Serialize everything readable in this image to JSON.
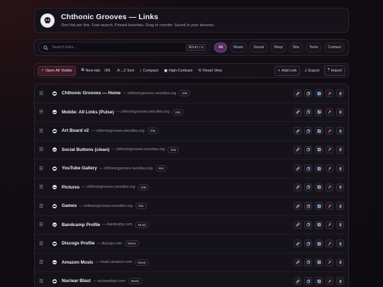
{
  "header": {
    "title": "Chthonic Grooves — Links",
    "subtitle": "One link per line. Fast search. Pinned favorites. Drag to reorder. Saved in your browser."
  },
  "search": {
    "placeholder": "Search links...",
    "shortcut": "⌘/Ctrl + K",
    "filters": [
      {
        "label": "All",
        "active": true
      },
      {
        "label": "Music",
        "active": false
      },
      {
        "label": "Social",
        "active": false
      },
      {
        "label": "Shop",
        "active": false
      },
      {
        "label": "Site",
        "active": false
      },
      {
        "label": "Tools",
        "active": false
      },
      {
        "label": "Contact",
        "active": false
      }
    ]
  },
  "toolbar": {
    "open_all": "Open All Visible",
    "new_tab_label": "New-tab:",
    "new_tab_value": "ON",
    "sort": "A→Z Sort",
    "compact": "Compact",
    "contrast": "High-Contrast",
    "reset": "Reset View",
    "add": "Add Link",
    "export": "Export",
    "import": "Import"
  },
  "links": [
    {
      "name": "Chthonic Grooves — Home",
      "domain": "chthonicgrooves.neocities.org",
      "tag": "Site"
    },
    {
      "name": "Mobile: All Links (Pulse)",
      "domain": "chthonicgrooves.neocities.org",
      "tag": "Site"
    },
    {
      "name": "Art Board v2",
      "domain": "chthonicgrooves.neocities.org",
      "tag": "Site"
    },
    {
      "name": "Social Buttons (clean)",
      "domain": "chthonicgrooves.neocities.org",
      "tag": "Site"
    },
    {
      "name": "YouTube Gallery",
      "domain": "chthonicgrooves.neocities.org",
      "tag": "Site"
    },
    {
      "name": "Pictures",
      "domain": "chthonicgrooves.neocities.org",
      "tag": "Site"
    },
    {
      "name": "Games",
      "domain": "chthonicgrooves.neocities.org",
      "tag": "Site"
    },
    {
      "name": "Bandcamp Profile",
      "domain": "bandcamp.com",
      "tag": "Music"
    },
    {
      "name": "Discogs Profile",
      "domain": "discogs.com",
      "tag": "Music"
    },
    {
      "name": "Amazon Music",
      "domain": "music.amazon.com",
      "tag": "Music"
    },
    {
      "name": "Nuclear Blast",
      "domain": "nuclearblast.com",
      "tag": "Music"
    }
  ],
  "colors": {
    "accent": "#5a2c60",
    "primary_button": "#3a1a24",
    "pin": "#e0474f",
    "background": "#0d0b10"
  }
}
